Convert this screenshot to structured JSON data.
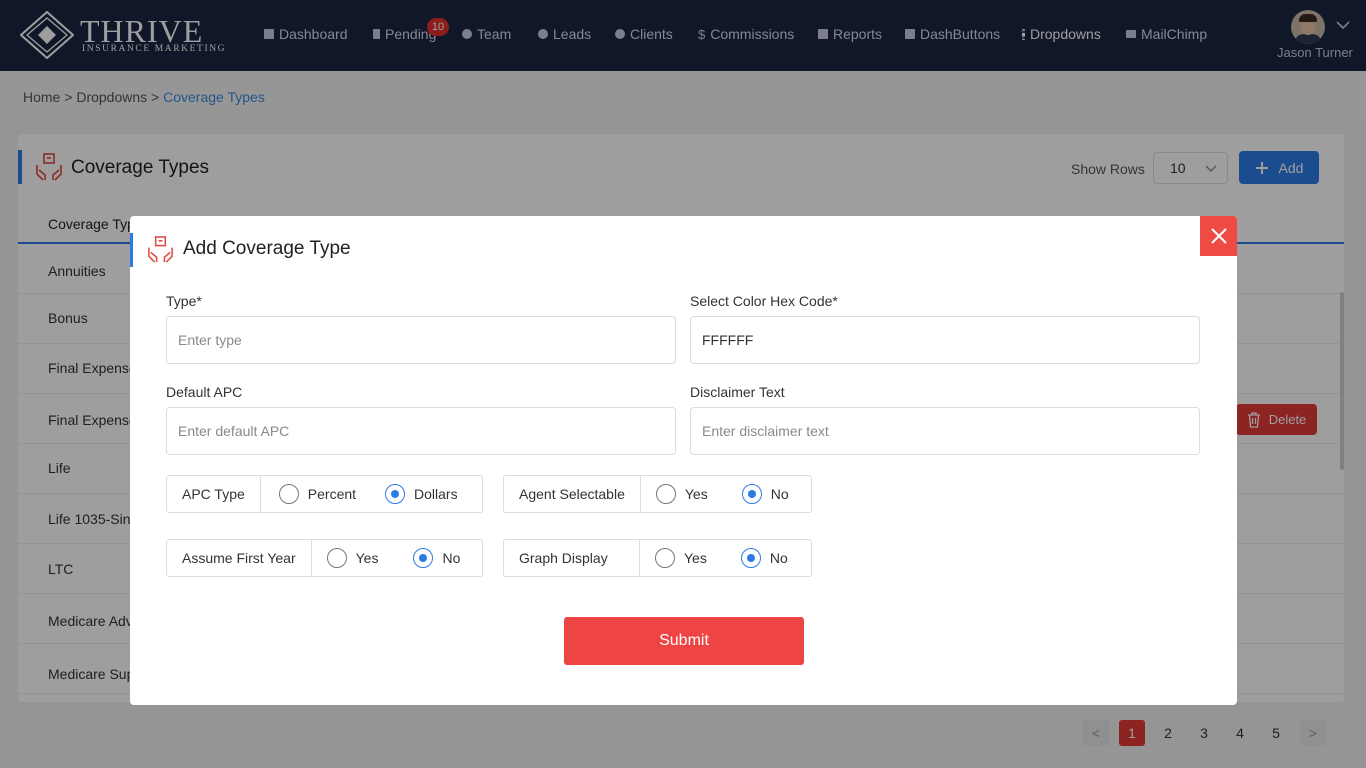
{
  "brand": {
    "name": "THRIVE",
    "tagline": "INSURANCE MARKETING"
  },
  "nav": {
    "items": [
      {
        "label": "Dashboard",
        "icon": "dashboard-icon"
      },
      {
        "label": "Pending",
        "icon": "hourglass-icon",
        "badge": "10"
      },
      {
        "label": "Team",
        "icon": "team-icon"
      },
      {
        "label": "Leads",
        "icon": "leaf-icon"
      },
      {
        "label": "Clients",
        "icon": "user-icon"
      },
      {
        "label": "Commissions",
        "icon": "dollar-icon",
        "glyph": "$"
      },
      {
        "label": "Reports",
        "icon": "report-icon"
      },
      {
        "label": "DashButtons",
        "icon": "calendar-icon"
      },
      {
        "label": "Dropdowns",
        "icon": "dots-vertical-icon",
        "active": true
      },
      {
        "label": "MailChimp",
        "icon": "mail-icon"
      }
    ],
    "user_name": "Jason Turner"
  },
  "breadcrumb": {
    "home": "Home",
    "sep1": ">",
    "section": "Dropdowns",
    "sep2": ">",
    "current": "Coverage Types"
  },
  "page": {
    "title": "Coverage Types",
    "show_rows_label": "Show Rows",
    "rows_value": "10",
    "add_label": "Add",
    "column_header": "Coverage Typ",
    "rows": [
      "Annuities",
      "Bonus",
      "Final Expense",
      "Final Expense",
      "Life",
      "Life 1035-Sin",
      "LTC",
      "Medicare Adv",
      "Medicare Sup"
    ],
    "delete_label": "Delete"
  },
  "pagination": {
    "prev": "<",
    "pages": [
      "1",
      "2",
      "3",
      "4",
      "5"
    ],
    "current": "1",
    "next": ">"
  },
  "modal": {
    "title": "Add Coverage Type",
    "type": {
      "label": "Type*",
      "placeholder": "Enter type",
      "value": ""
    },
    "color": {
      "label": "Select Color Hex Code*",
      "value": "FFFFFF"
    },
    "default_apc": {
      "label": "Default APC",
      "placeholder": "Enter default APC"
    },
    "disclaimer": {
      "label": "Disclaimer Text",
      "placeholder": "Enter disclaimer text"
    },
    "apc_type": {
      "label": "APC Type",
      "options": [
        "Percent",
        "Dollars"
      ],
      "selected": "Dollars"
    },
    "agent_selectable": {
      "label": "Agent Selectable",
      "options": [
        "Yes",
        "No"
      ],
      "selected": "No"
    },
    "assume_first_year": {
      "label": "Assume First Year",
      "options": [
        "Yes",
        "No"
      ],
      "selected": "No"
    },
    "graph_display": {
      "label": "Graph Display",
      "options": [
        "Yes",
        "No"
      ],
      "selected": "No"
    },
    "submit_label": "Submit"
  },
  "colors": {
    "nav_bg": "#1b2642",
    "accent": "#2c7be5",
    "danger": "#ef4444"
  }
}
